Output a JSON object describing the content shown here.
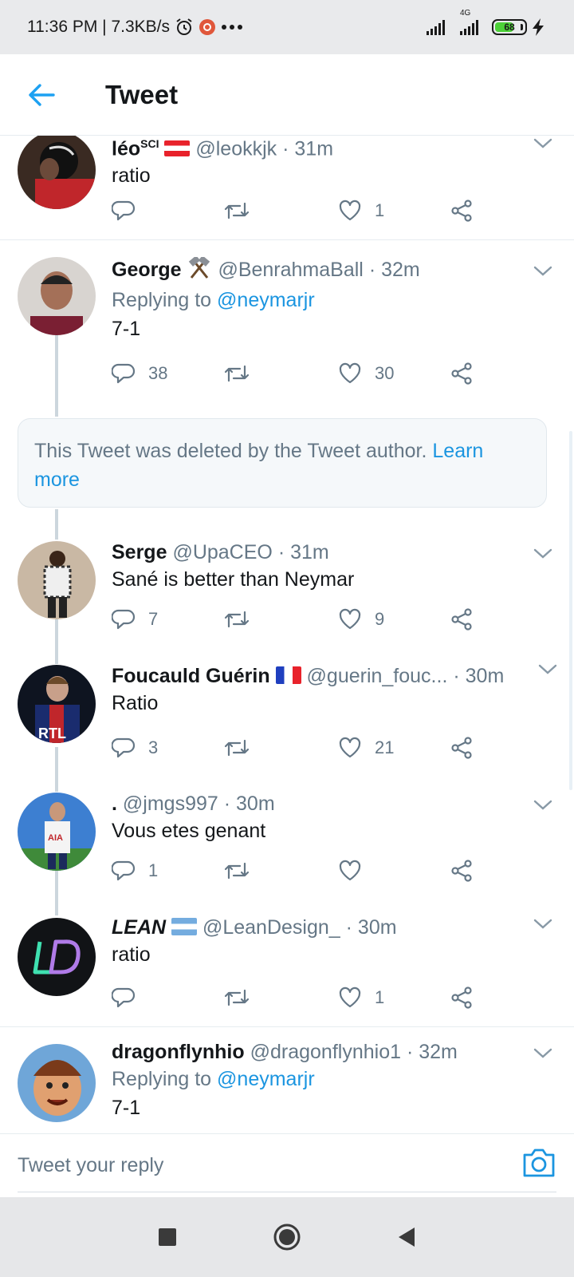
{
  "status_bar": {
    "time": "11:36 PM | 7.3KB/s",
    "network_label": "4G",
    "battery": "68",
    "battery_level": 0.68
  },
  "header": {
    "title": "Tweet"
  },
  "tweets": [
    {
      "name": "léo",
      "name_sup": "SCI",
      "handle": "@leokkjk",
      "sep": "·",
      "time": "31m",
      "text": "ratio",
      "reply_count": "",
      "like_count": "1"
    },
    {
      "name": "George",
      "handle": "@BenrahmaBall",
      "sep": "·",
      "time": "32m",
      "replying_prefix": "Replying to",
      "replying_to": "@neymarjr",
      "text": "7-1",
      "reply_count": "38",
      "like_count": "30"
    },
    {
      "name": "Serge",
      "handle": "@UpaCEO",
      "sep": "·",
      "time": "31m",
      "text": "Sané is better than Neymar",
      "reply_count": "7",
      "like_count": "9"
    },
    {
      "name": "Foucauld Guérin",
      "handle": "@guerin_fouc...",
      "sep": "·",
      "time": "30m",
      "text": "Ratio",
      "reply_count": "3",
      "like_count": "21"
    },
    {
      "name": ".",
      "handle": "@jmgs997",
      "sep": "·",
      "time": "30m",
      "text": "Vous etes genant",
      "reply_count": "1",
      "like_count": ""
    },
    {
      "name": "LEAN",
      "handle": "@LeanDesign_",
      "sep": "·",
      "time": "30m",
      "text": "ratio",
      "reply_count": "",
      "like_count": "1"
    },
    {
      "name": "dragonflynhio",
      "handle": "@dragonflynhio1",
      "sep": "·",
      "time": "32m",
      "replying_prefix": "Replying to",
      "replying_to": "@neymarjr",
      "text": "7-1"
    }
  ],
  "deleted_notice": {
    "text": "This Tweet was deleted by the Tweet author.",
    "link_line1": "Learn",
    "link_line2": "more"
  },
  "reply_bar": {
    "placeholder": "Tweet your reply"
  },
  "colors": {
    "accent": "#1b95e0",
    "secondary_text": "#657786",
    "primary_text": "#14171a"
  },
  "icons": [
    "back-arrow-icon",
    "reply-icon",
    "retweet-icon",
    "like-icon",
    "share-icon",
    "chevron-down-icon",
    "camera-icon",
    "alarm-icon",
    "signal-icon",
    "battery-icon",
    "bolt-icon"
  ]
}
